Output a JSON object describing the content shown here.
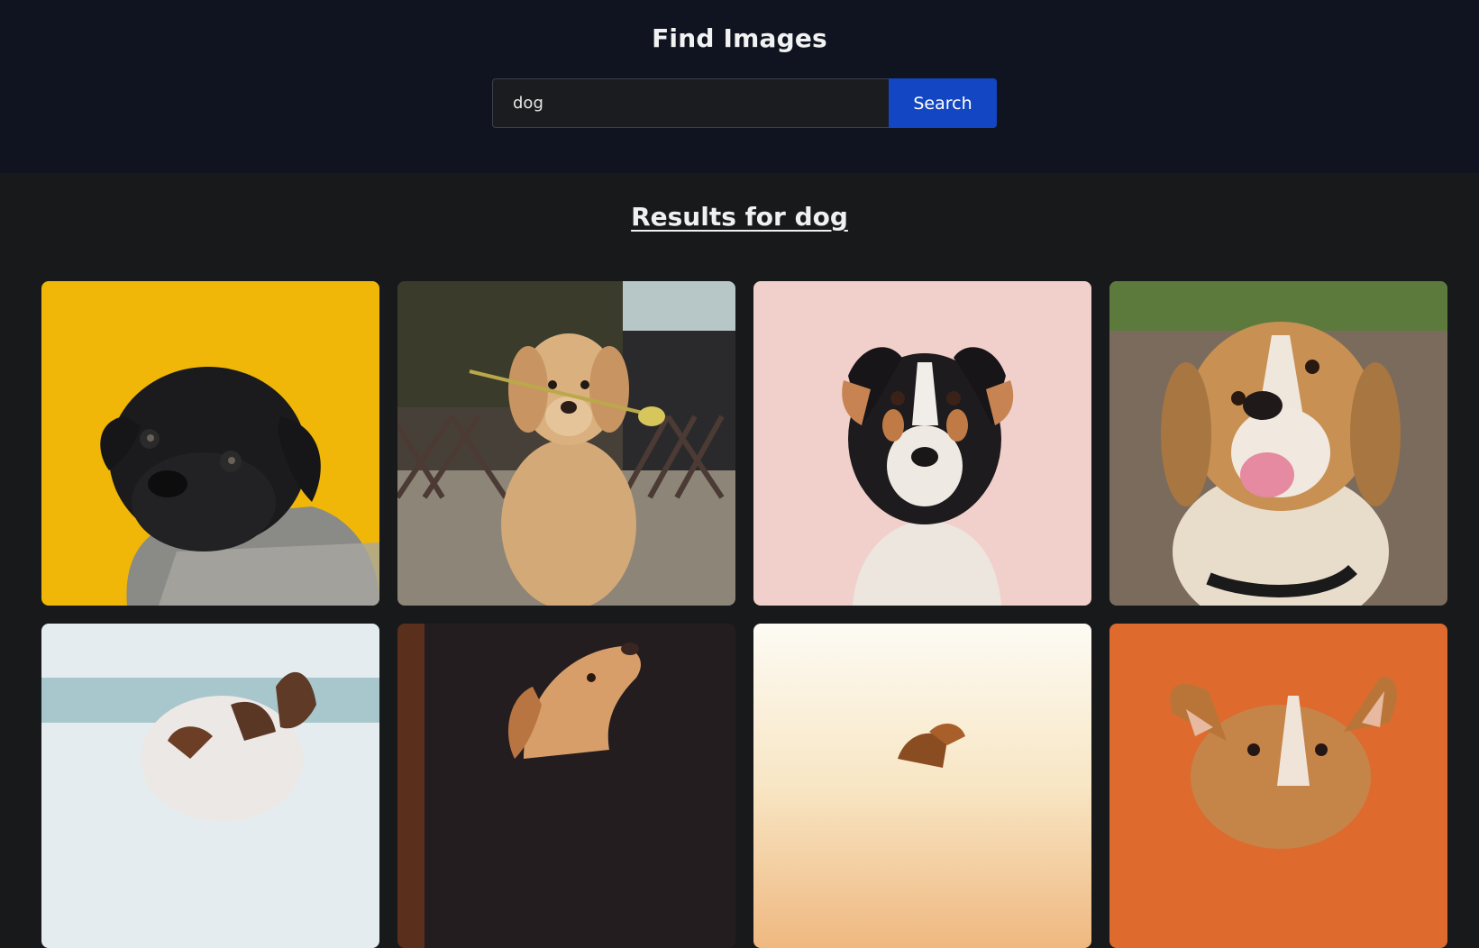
{
  "header": {
    "title": "Find Images",
    "search": {
      "value": "dog",
      "placeholder": ""
    },
    "search_button_label": "Search"
  },
  "results": {
    "heading": "Results for dog"
  },
  "images": [
    {
      "id": "image-1",
      "subject": "black pug in grey knit sweater",
      "bg": "#f0b708"
    },
    {
      "id": "image-2",
      "subject": "golden retriever holding tulip",
      "bg": "#5a5048"
    },
    {
      "id": "image-3",
      "subject": "tricolor terrier on pink",
      "bg": "#f1d0cb"
    },
    {
      "id": "image-4",
      "subject": "smiling beagle",
      "bg": "#7c6e5e"
    },
    {
      "id": "image-5",
      "subject": "brown and white dog near sea",
      "bg": "#cfdde2"
    },
    {
      "id": "image-6",
      "subject": "yellow labrador looking up",
      "bg": "#231d1f"
    },
    {
      "id": "image-7",
      "subject": "dog at sunset",
      "bg": "#fbf3e3"
    },
    {
      "id": "image-8",
      "subject": "corgi on orange",
      "bg": "#de6a2e"
    }
  ]
}
